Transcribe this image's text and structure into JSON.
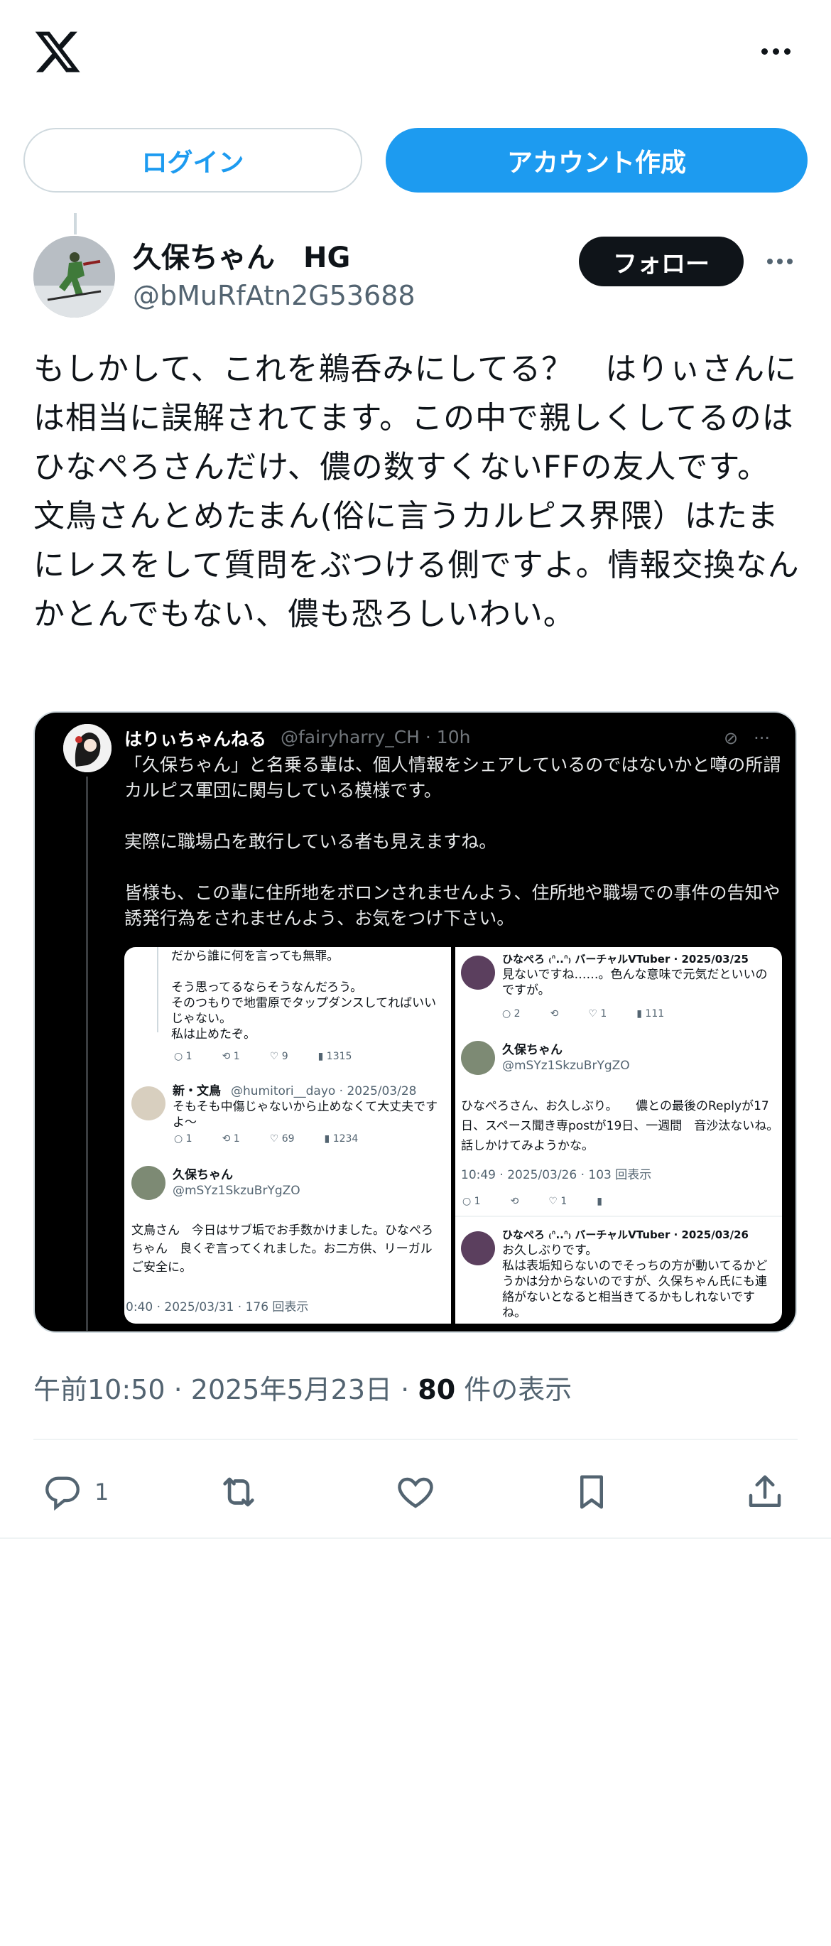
{
  "topbar": {
    "logo": "x-logo-icon",
    "more": "more-icon"
  },
  "auth": {
    "login_label": "ログイン",
    "signup_label": "アカウント作成"
  },
  "post": {
    "author_name": "久保ちゃん　HG",
    "author_handle": "@bMuRfAtn2G53688",
    "follow_label": "フォロー",
    "text": "もしかして、これを鵜呑みにしてる？　はりぃさんには相当に誤解されてます。この中で親しくしてるのはひなぺろさんだけ、儂の数すくないFFの友人です。文鳥さんとめたまん(俗に言うカルピス界隈）はたまにレスをして質問をぶつける側ですよ。情報交換なんかとんでもない、儂も恐ろしいわい。",
    "time": "午前10:50",
    "date": "2025年5月23日",
    "views": "80",
    "views_label": "件の表示",
    "reply_count": "1"
  },
  "media": {
    "quote_name": "はりぃちゃんねる",
    "quote_meta": "@fairyharry_CH · 10h",
    "quote_text": "「久保ちゃん」と名乗る輩は、個人情報をシェアしているのではないかと噂の所謂カルピス軍団に関与している模様です。\n\n実際に職場凸を敢行している者も見えますね。\n\n皆様も、この輩に住所地をボロンされませんよう、住所地や職場での事件の告知や誘発行為をされませんよう、お気をつけ下さい。",
    "left": {
      "text1": "だから誰に何を言っても無罪。\n\nそう思ってるならそうなんだろう。\nそのつもりで地雷原でタップダンスしてればいいじゃない。\n私は止めたぞ。",
      "stats1": [
        "1",
        "1",
        "9",
        "1315"
      ],
      "name2": "新・文鳥",
      "handle2": "@humitori__dayo · 2025/03/28",
      "text2": "そもそも中傷じゃないから止めなくて大丈夫ですよ〜",
      "stats2": [
        "1",
        "1",
        "69",
        "1234"
      ],
      "name3": "久保ちゃん",
      "handle3": "@mSYz1SkzuBrYgZO",
      "text3": "文鳥さん　今日はサブ垢でお手数かけました。ひなぺろちゃん　良くぞ言ってくれました。お二方供、リーガルご安全に。",
      "footer3": "0:40 · 2025/03/31 · 176 回表示"
    },
    "right": {
      "name1": "ひなぺろ ₍ᐢ..ᐢ₎ バーチャルVTuber · 2025/03/25",
      "text1": "見ないですね……。色んな意味で元気だといいのですが。",
      "stats1": [
        "2",
        "",
        "1",
        "111"
      ],
      "name2": "久保ちゃん",
      "handle2": "@mSYz1SkzuBrYgZO",
      "text2": "ひなぺろさん、お久しぶり。　　儂との最後のReplyが17日、スペース聞き専postが19日、一週間　音沙汰ないね。　話しかけてみようかな。",
      "footer2": "10:49 · 2025/03/26 · 103 回表示",
      "stats2": [
        "1",
        "",
        "1",
        ""
      ],
      "name3": "ひなぺろ ₍ᐢ..ᐢ₎ バーチャルVTuber · 2025/03/26",
      "text3": "お久しぶりです。\n私は表垢知らないのでそっちの方が動いてるかどうかは分からないのですが、久保ちゃん氏にも連絡がないとなると相当きてるかもしれないですね。"
    }
  }
}
